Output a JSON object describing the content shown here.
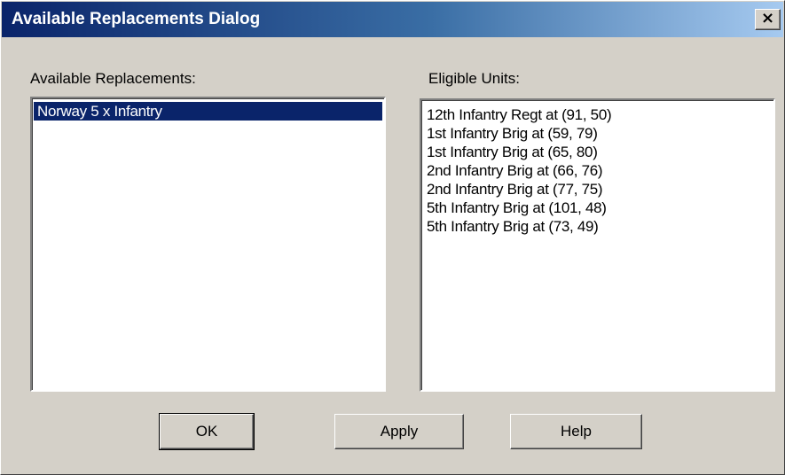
{
  "window": {
    "title": "Available Replacements Dialog",
    "close_glyph": "×"
  },
  "replacements": {
    "label": "Available Replacements:",
    "items": [
      "Norway 5 x Infantry"
    ],
    "selected_index": 0
  },
  "eligible": {
    "label": "Eligible Units:",
    "items": [
      "12th Infantry Regt at (91, 50)",
      "1st Infantry Brig at (59, 79)",
      "1st Infantry Brig at (65, 80)",
      "2nd Infantry Brig at (66, 76)",
      "2nd Infantry Brig at (77, 75)",
      "5th Infantry Brig at (101, 48)",
      "5th Infantry Brig at (73, 49)"
    ]
  },
  "buttons": {
    "ok": "OK",
    "apply": "Apply",
    "help": "Help"
  },
  "colors": {
    "titlebar_start": "#0a246a",
    "titlebar_end": "#a6caf0",
    "selection": "#0a246a",
    "face": "#d4d0c8"
  }
}
